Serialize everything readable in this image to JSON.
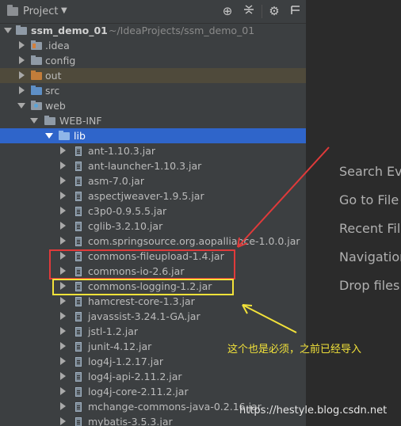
{
  "toolbar": {
    "title": "Project",
    "caret": "▼",
    "icons": [
      "target-icon",
      "collapse-icon",
      "gear-icon",
      "hide-icon"
    ]
  },
  "tree": {
    "root": {
      "name": "ssm_demo_01",
      "path": "~/IdeaProjects/ssm_demo_01"
    },
    "folders": {
      "idea": ".idea",
      "config": "config",
      "out": "out",
      "src": "src",
      "web": "web",
      "webinf": "WEB-INF",
      "lib": "lib"
    },
    "jars": [
      "ant-1.10.3.jar",
      "ant-launcher-1.10.3.jar",
      "asm-7.0.jar",
      "aspectjweaver-1.9.5.jar",
      "c3p0-0.9.5.5.jar",
      "cglib-3.2.10.jar",
      "com.springsource.org.aopalliance-1.0.0.jar",
      "commons-fileupload-1.4.jar",
      "commons-io-2.6.jar",
      "commons-logging-1.2.jar",
      "hamcrest-core-1.3.jar",
      "javassist-3.24.1-GA.jar",
      "jstl-1.2.jar",
      "junit-4.12.jar",
      "log4j-1.2.17.jar",
      "log4j-api-2.11.2.jar",
      "log4j-core-2.11.2.jar",
      "mchange-commons-java-0.2.16.jar",
      "mybatis-3.5.3.jar"
    ]
  },
  "editor_hints": [
    "Search Eve",
    "Go to File",
    "Recent File",
    "Navigation",
    "Drop files"
  ],
  "annotation": {
    "note": "这个也是必须，之前已经导入",
    "red_color": "#e03a3a",
    "yellow_color": "#f2e23a"
  },
  "watermark": "https://hestyle.blog.csdn.net"
}
